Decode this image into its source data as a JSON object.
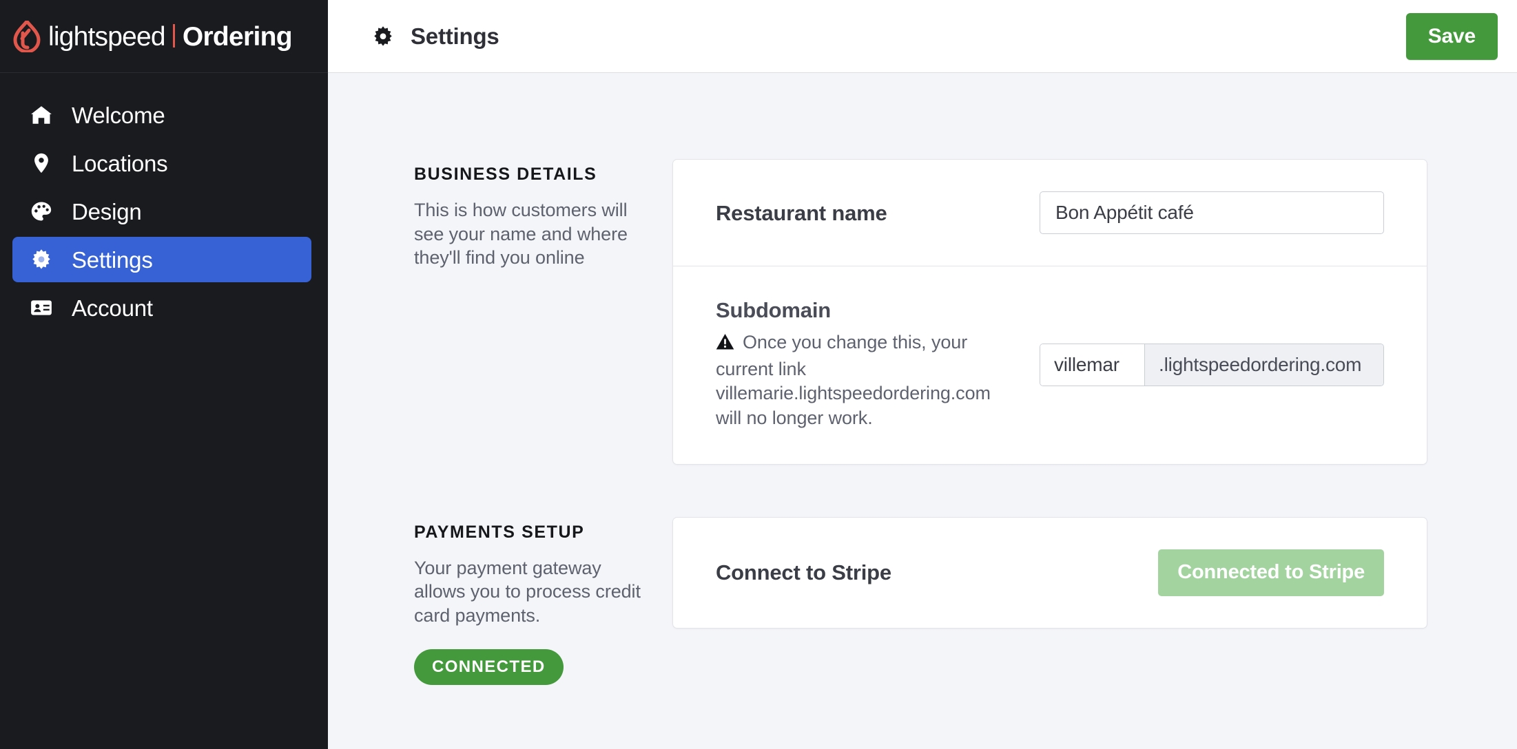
{
  "brand": {
    "logo_icon": "lightspeed-flame-logo",
    "word": "lightspeed",
    "product": "Ordering"
  },
  "sidebar": {
    "items": [
      {
        "label": "Welcome",
        "icon": "home-icon",
        "active": false
      },
      {
        "label": "Locations",
        "icon": "map-pin-icon",
        "active": false
      },
      {
        "label": "Design",
        "icon": "palette-icon",
        "active": false
      },
      {
        "label": "Settings",
        "icon": "gear-icon",
        "active": true
      },
      {
        "label": "Account",
        "icon": "id-card-icon",
        "active": false
      }
    ]
  },
  "topbar": {
    "icon": "gear-icon",
    "title": "Settings",
    "save_label": "Save"
  },
  "business_details": {
    "aside_title": "BUSINESS DETAILS",
    "aside_desc": "This is how customers will see your name and where they'll find you online",
    "restaurant_name_label": "Restaurant name",
    "restaurant_name_value": "Bon Appétit café",
    "restaurant_name_placeholder": "Restaurant name",
    "subdomain_label": "Subdomain",
    "subdomain_warning_icon": "warning-triangle-icon",
    "subdomain_warning": "Once you change this, your current link villemarie.lightspeedordering.com will no longer work.",
    "subdomain_value": "villemar",
    "subdomain_placeholder": "subdomain",
    "subdomain_suffix": ".lightspeedordering.com"
  },
  "payments_setup": {
    "aside_title": "PAYMENTS SETUP",
    "aside_desc": "Your payment gateway allows you to process credit card payments.",
    "status_badge": "CONNECTED",
    "stripe_label": "Connect to Stripe",
    "stripe_button_label": "Connected to Stripe"
  },
  "colors": {
    "sidebar_bg": "#1a1b1f",
    "active_nav": "#3762d6",
    "brand_red": "#e2574c",
    "save_green": "#43993b",
    "badge_green": "#43993b",
    "stripe_disabled_green": "#a3d4a0",
    "page_bg": "#f4f5f8"
  }
}
